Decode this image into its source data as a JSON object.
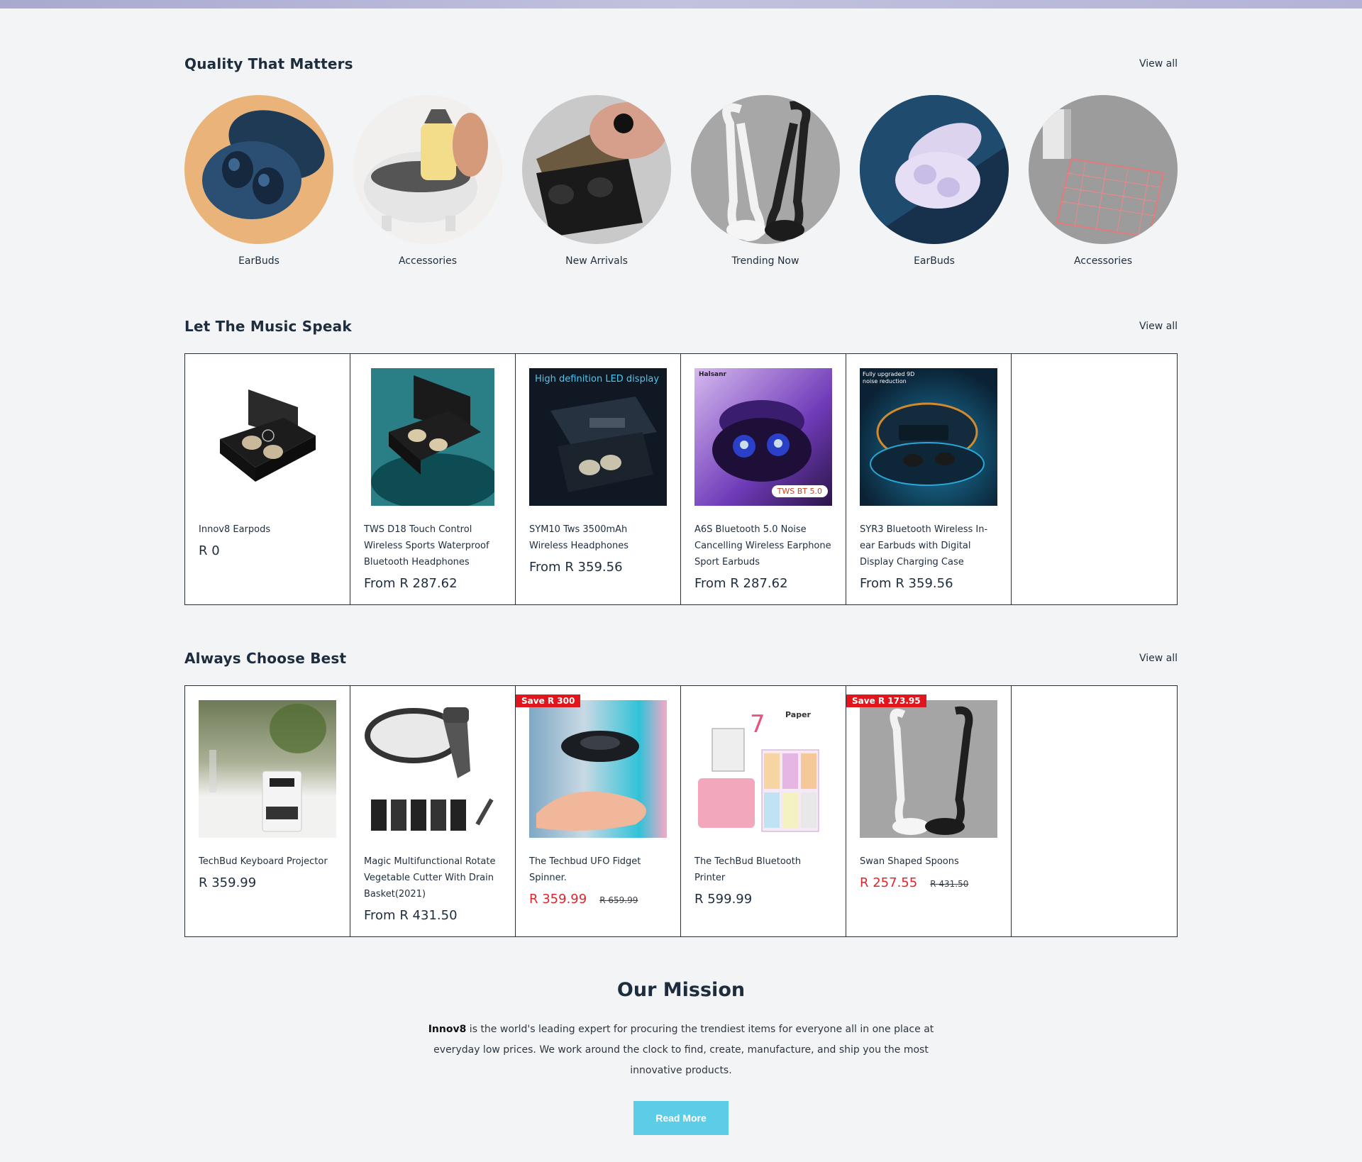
{
  "collections_section": {
    "title": "Quality That Matters",
    "view_all": "View all",
    "items": [
      {
        "label": "EarBuds"
      },
      {
        "label": "Accessories"
      },
      {
        "label": "New Arrivals"
      },
      {
        "label": "Trending Now"
      },
      {
        "label": "EarBuds"
      },
      {
        "label": "Accessories"
      }
    ]
  },
  "music_section": {
    "title": "Let The Music Speak",
    "view_all": "View all",
    "products": [
      {
        "title": "Innov8 Earpods",
        "price": "R 0"
      },
      {
        "title": "TWS D18 Touch Control Wireless Sports Waterproof Bluetooth Headphones",
        "price": "From R 287.62"
      },
      {
        "title": "SYM10 Tws 3500mAh Wireless Headphones",
        "price": "From R 359.56",
        "image_text": "High definition LED display"
      },
      {
        "title": "A6S Bluetooth 5.0 Noise Cancelling Wireless Earphone Sport Earbuds",
        "price": "From R 287.62",
        "image_text": "Halsanr",
        "image_tag": "TWS BT 5.0"
      },
      {
        "title": "SYR3 Bluetooth Wireless In-ear Earbuds with Digital Display Charging Case",
        "price": "From R 359.56",
        "image_text": "Fully upgraded 9D noise reduction"
      }
    ]
  },
  "best_section": {
    "title": "Always Choose Best",
    "view_all": "View all",
    "products": [
      {
        "title": "TechBud Keyboard Projector",
        "price": "R 359.99"
      },
      {
        "title": "Magic Multifunctional Rotate Vegetable Cutter With Drain Basket(2021)",
        "price": "From R 431.50"
      },
      {
        "title": "The Techbud UFO Fidget Spinner.",
        "badge": "Save R 300",
        "sale_price": "R 359.99",
        "old_price": "R 659.99"
      },
      {
        "title": "The TechBud Bluetooth Printer",
        "price": "R 599.99",
        "image_text": "Paper"
      },
      {
        "title": "Swan Shaped Spoons",
        "badge": "Save R 173.95",
        "sale_price": "R 257.55",
        "old_price": "R 431.50"
      }
    ]
  },
  "mission": {
    "title": "Our Mission",
    "brand": "Innov8",
    "text": " is the world's leading expert for procuring the trendiest items for everyone all in one place at everyday low prices. We work around the clock to find, create, manufacture, and ship you the most innovative products.",
    "button": "Read More"
  },
  "colors": {
    "accent": "#5ccde6",
    "sale": "#e0262c",
    "badge": "#e0161c",
    "text": "#1e2d3d"
  }
}
